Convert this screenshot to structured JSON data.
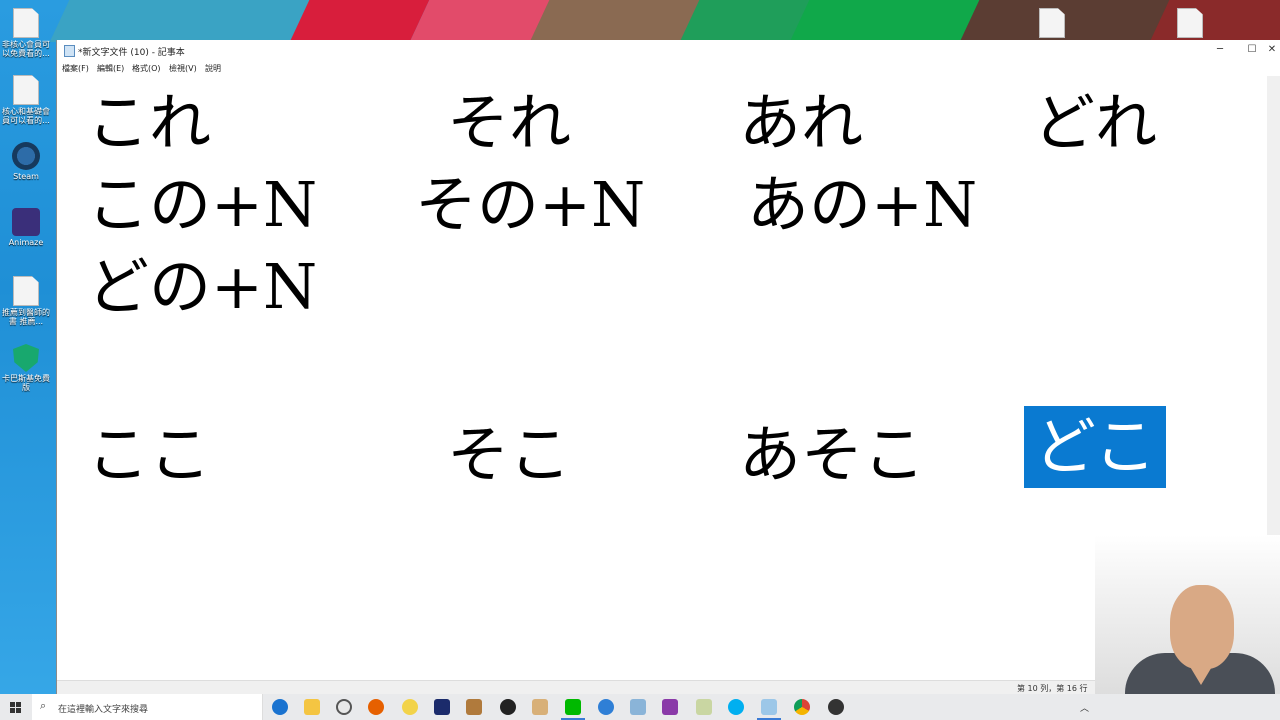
{
  "desktop": {
    "icons": [
      {
        "label": "非核心會員可以免費看的...",
        "icon": "text-file-icon"
      },
      {
        "label": "核心和基礎會員可以看的...",
        "icon": "text-file-icon"
      },
      {
        "label": "Steam",
        "icon": "steam-icon"
      },
      {
        "label": "Animaze",
        "icon": "animaze-icon"
      },
      {
        "label": "推薦到醫師的書 推薦...",
        "icon": "text-file-icon"
      },
      {
        "label": "卡巴斯基免費版",
        "icon": "kaspersky-free-icon"
      }
    ]
  },
  "window": {
    "title": "*新文字文件 (10) - 記事本",
    "minimize": "─",
    "maximize": "☐",
    "close": "✕"
  },
  "menu": [
    "檔案(F)",
    "編輯(E)",
    "格式(O)",
    "檢視(V)",
    "說明"
  ],
  "editor": {
    "row1": [
      "これ",
      "それ",
      "あれ",
      "どれ"
    ],
    "row2": [
      "この+N",
      "その+N",
      "あの+N"
    ],
    "row3": [
      "どの+N"
    ],
    "row4": [
      "ここ",
      "そこ",
      "あそこ",
      "どこ"
    ],
    "selected_text": "どこ"
  },
  "status": {
    "position": "第 10 列，第 16 行"
  },
  "taskbar": {
    "search_placeholder": "在這裡輸入文字來搜尋",
    "apps": [
      "edge-icon",
      "file-explorer-icon",
      "search-app-icon",
      "firefox-icon",
      "lemon-icon",
      "music-icon",
      "tool-icon",
      "obs-icon",
      "book-icon",
      "line-icon",
      "qbittorrent-icon",
      "puzzle-icon",
      "winrar-icon",
      "brush-icon",
      "skype-icon",
      "notepad-icon",
      "chrome-icon",
      "media-icon"
    ]
  },
  "colors": {
    "selection": "#0a7ad1",
    "desktop": "#1f8fd6"
  }
}
